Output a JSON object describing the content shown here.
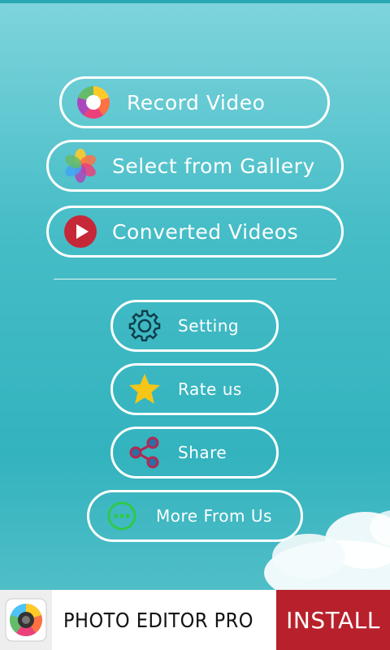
{
  "main_menu": {
    "record_video": {
      "label": "Record Video",
      "icon": "camera-shutter-icon"
    },
    "select_gallery": {
      "label": "Select from Gallery",
      "icon": "gallery-flower-icon"
    },
    "converted_videos": {
      "label": "Converted Videos",
      "icon": "play-icon"
    }
  },
  "secondary_menu": {
    "setting": {
      "label": "Setting",
      "icon": "gear-icon"
    },
    "rate_us": {
      "label": "Rate us",
      "icon": "star-icon"
    },
    "share": {
      "label": "Share",
      "icon": "share-icon"
    },
    "more_from_us": {
      "label": "More From Us",
      "icon": "more-dots-icon"
    }
  },
  "ad_banner": {
    "title": "PHOTO EDITOR PRO",
    "install_label": "INSTALL",
    "icon": "photo-editor-app-icon"
  },
  "colors": {
    "background": "#46bdc7",
    "button_border": "#ffffff",
    "install_button": "#b8202b",
    "play_icon": "#c62838",
    "star_icon": "#f5c518",
    "share_icon": "#b02a52",
    "more_icon": "#2ec94a"
  }
}
